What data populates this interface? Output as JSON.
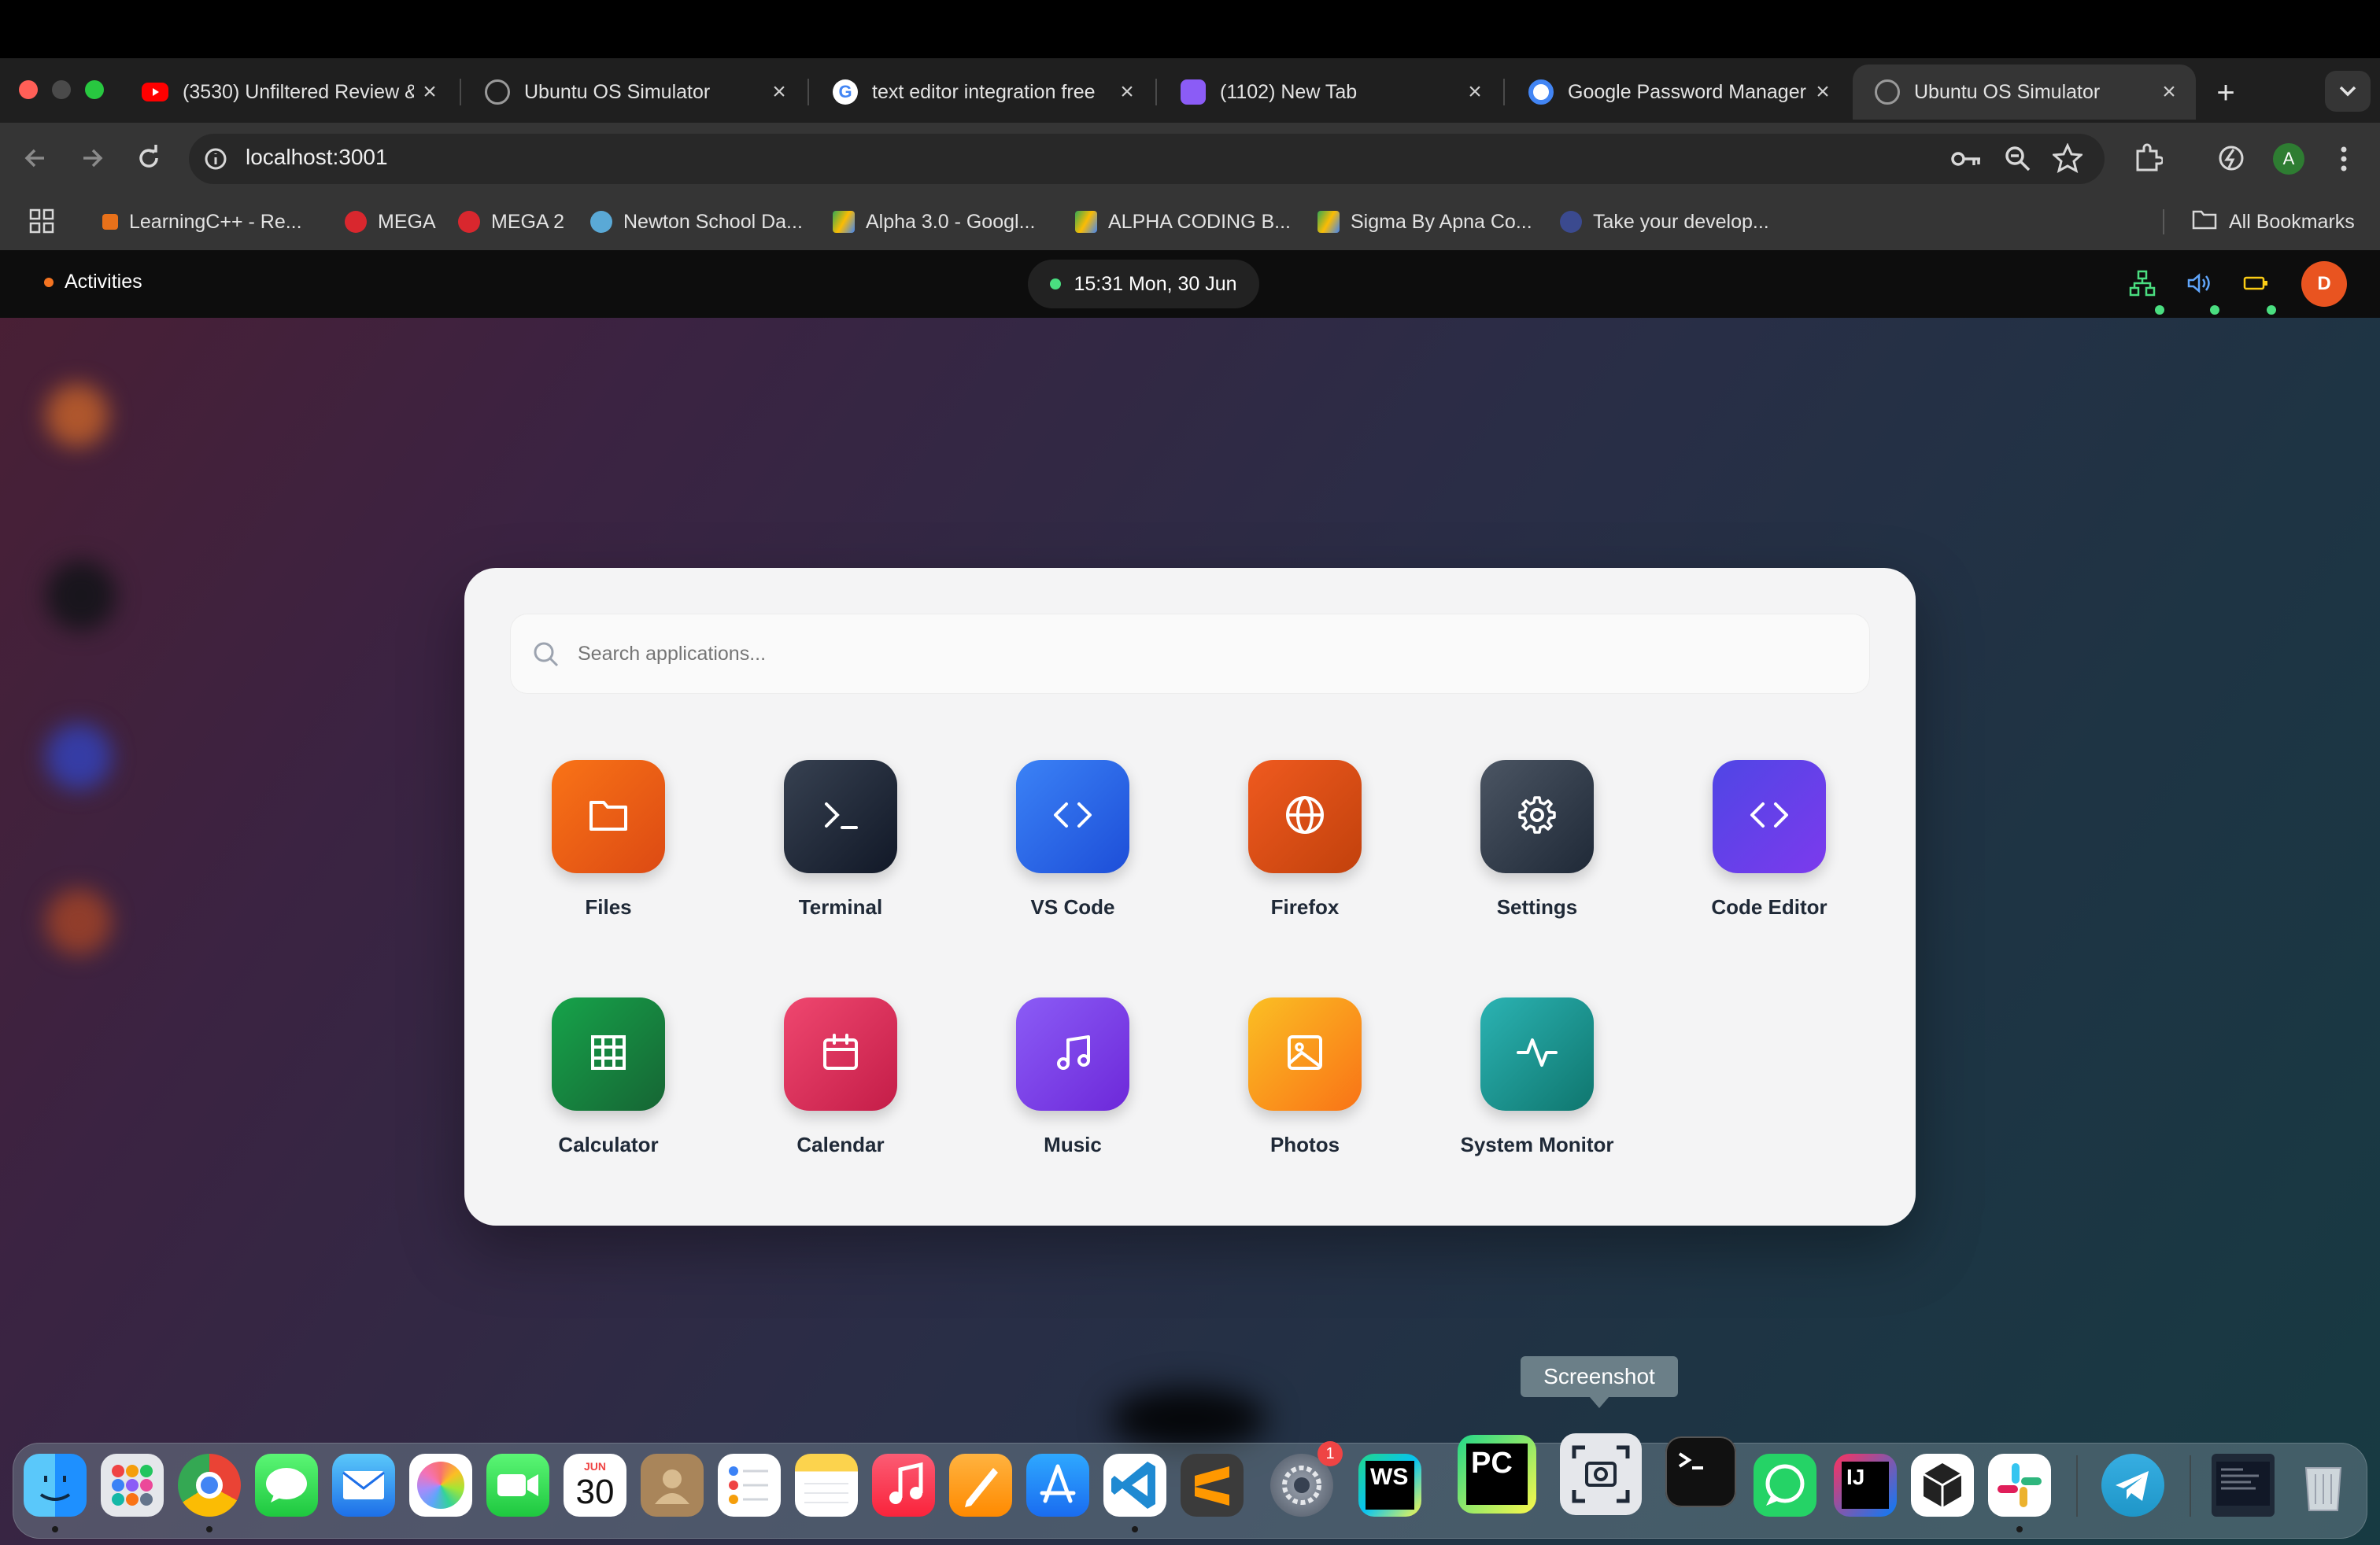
{
  "browser": {
    "tabs": [
      {
        "title": "(3530) Unfiltered Review & ",
        "favicon": "youtube-icon"
      },
      {
        "title": "Ubuntu OS Simulator",
        "favicon": "globe-icon"
      },
      {
        "title": "text editor integration free",
        "favicon": "google-icon"
      },
      {
        "title": "(1102) New Tab",
        "favicon": "app-icon"
      },
      {
        "title": "Google Password Manager",
        "favicon": "password-manager-icon"
      },
      {
        "title": "Ubuntu OS Simulator",
        "favicon": "globe-icon",
        "active": true
      }
    ],
    "new_tab": "+",
    "url": "localhost:3001",
    "profile_initial": "A",
    "bookmarks": [
      "LearningC++ - Re...",
      "MEGA",
      "MEGA 2",
      "Newton School Da...",
      "Alpha 3.0 - Googl...",
      "ALPHA CODING B...",
      "Sigma By Apna Co...",
      "Take your develop..."
    ],
    "all_bookmarks": "All Bookmarks"
  },
  "topbar": {
    "activities": "Activities",
    "clock": "15:31 Mon, 30 Jun",
    "user_initial": "D",
    "status_icons": [
      "network-icon",
      "volume-icon",
      "battery-icon"
    ]
  },
  "launcher": {
    "search_placeholder": "Search applications...",
    "apps": [
      {
        "label": "Files",
        "icon": "folder-icon",
        "color": "#ea580c"
      },
      {
        "label": "Terminal",
        "icon": "terminal-icon",
        "color": "#1f2937"
      },
      {
        "label": "VS Code",
        "icon": "code-icon",
        "color": "#2563eb"
      },
      {
        "label": "Firefox",
        "icon": "globe-icon",
        "color": "#dc4a1a"
      },
      {
        "label": "Settings",
        "icon": "gear-icon",
        "color": "#374151"
      },
      {
        "label": "Code Editor",
        "icon": "code-icon",
        "color": "#4f46e5"
      },
      {
        "label": "Calculator",
        "icon": "grid-icon",
        "color": "#15803d"
      },
      {
        "label": "Calendar",
        "icon": "calendar-icon",
        "color": "#db2f5a"
      },
      {
        "label": "Music",
        "icon": "music-icon",
        "color": "#7c3aed"
      },
      {
        "label": "Photos",
        "icon": "image-icon",
        "color": "#f59e0b"
      },
      {
        "label": "System Monitor",
        "icon": "activity-icon",
        "color": "#0d9488"
      }
    ]
  },
  "dock": {
    "tooltip": "Screenshot",
    "calendar_month": "JUN",
    "calendar_day": "30",
    "settings_badge": "1",
    "ws_label": "WS",
    "pc_label": "PC",
    "ij_label": "IJ",
    "items": [
      "finder-icon",
      "launchpad-icon",
      "chrome-icon",
      "messages-icon",
      "mail-icon",
      "photos-icon",
      "facetime-icon",
      "calendar-icon",
      "contacts-icon",
      "reminders-icon",
      "notes-icon",
      "music-icon",
      "pages-icon",
      "app-store-icon",
      "vscode-icon",
      "sublime-icon",
      "system-settings-icon",
      "webstorm-icon",
      "pycharm-icon",
      "screenshot-icon",
      "terminal-icon",
      "whatsapp-icon",
      "intellij-icon",
      "unity-icon",
      "slack-icon",
      "telegram-icon",
      "window-preview-icon",
      "trash-icon"
    ]
  }
}
